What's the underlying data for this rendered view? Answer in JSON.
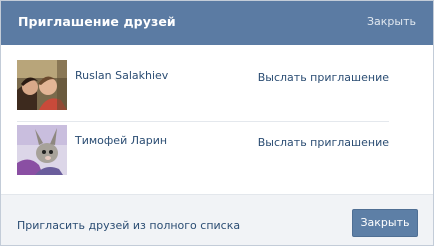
{
  "dialog": {
    "title": "Приглашение друзей",
    "close_link": "Закрыть"
  },
  "friends": [
    {
      "name": "Ruslan Salakhiev",
      "action": "Выслать приглашение",
      "avatar_icon": "friend-photo"
    },
    {
      "name": "Тимофей Ларин",
      "action": "Выслать приглашение",
      "avatar_icon": "friend-photo"
    }
  ],
  "footer": {
    "full_list_link": "Пригласить друзей из полного списка",
    "close_button": "Закрыть"
  },
  "colors": {
    "header_bg": "#5b7ba3",
    "link": "#2b4d73",
    "button_bg": "#5d7fa6"
  }
}
